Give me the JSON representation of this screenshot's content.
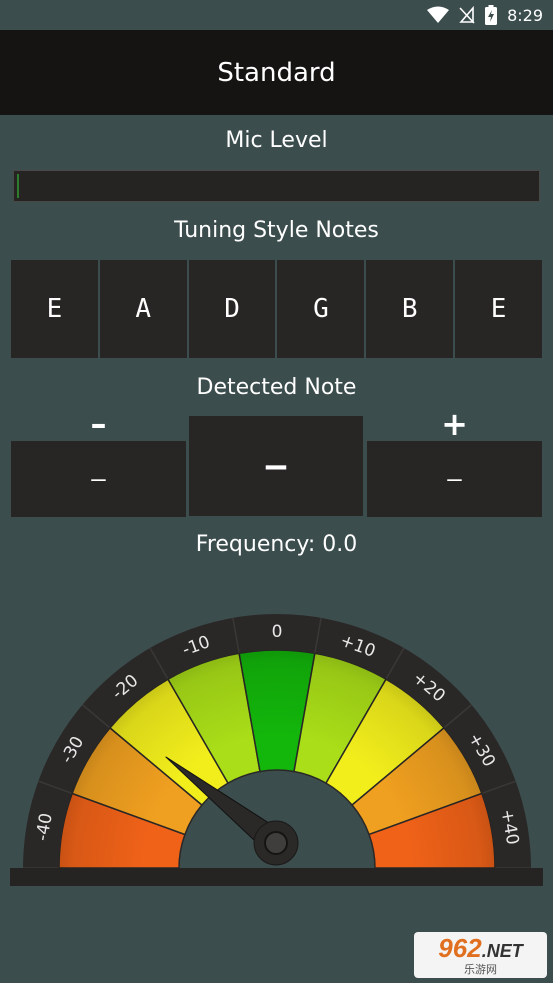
{
  "status_bar": {
    "time": "8:29",
    "icons": [
      "wifi-icon",
      "no-signal-icon",
      "battery-charging-icon"
    ]
  },
  "app_bar": {
    "title": "Standard"
  },
  "mic": {
    "label": "Mic Level",
    "level": 0.0
  },
  "tuning": {
    "label": "Tuning Style Notes",
    "notes": [
      "E",
      "A",
      "D",
      "G",
      "B",
      "E"
    ]
  },
  "detected": {
    "label": "Detected Note",
    "flat_sign": "–",
    "sharp_sign": "+",
    "flat_note": "–",
    "current_note": "–",
    "sharp_note": "–"
  },
  "frequency": {
    "label": "Frequency: 0.0"
  },
  "gauge": {
    "ticks": [
      "-40",
      "-30",
      "-20",
      "-10",
      "0",
      "+10",
      "+20",
      "+30",
      "+40"
    ],
    "needle_cents": -26,
    "colors": {
      "red": "#f06218",
      "orange": "#f0a020",
      "yellow": "#f2ee1c",
      "lime": "#a9de18",
      "green": "#13b60b",
      "ring": "#2a2826",
      "needle": "#2b2927"
    }
  },
  "watermark": {
    "brand": "962",
    "suffix": ".NET",
    "sub": "乐游网"
  }
}
